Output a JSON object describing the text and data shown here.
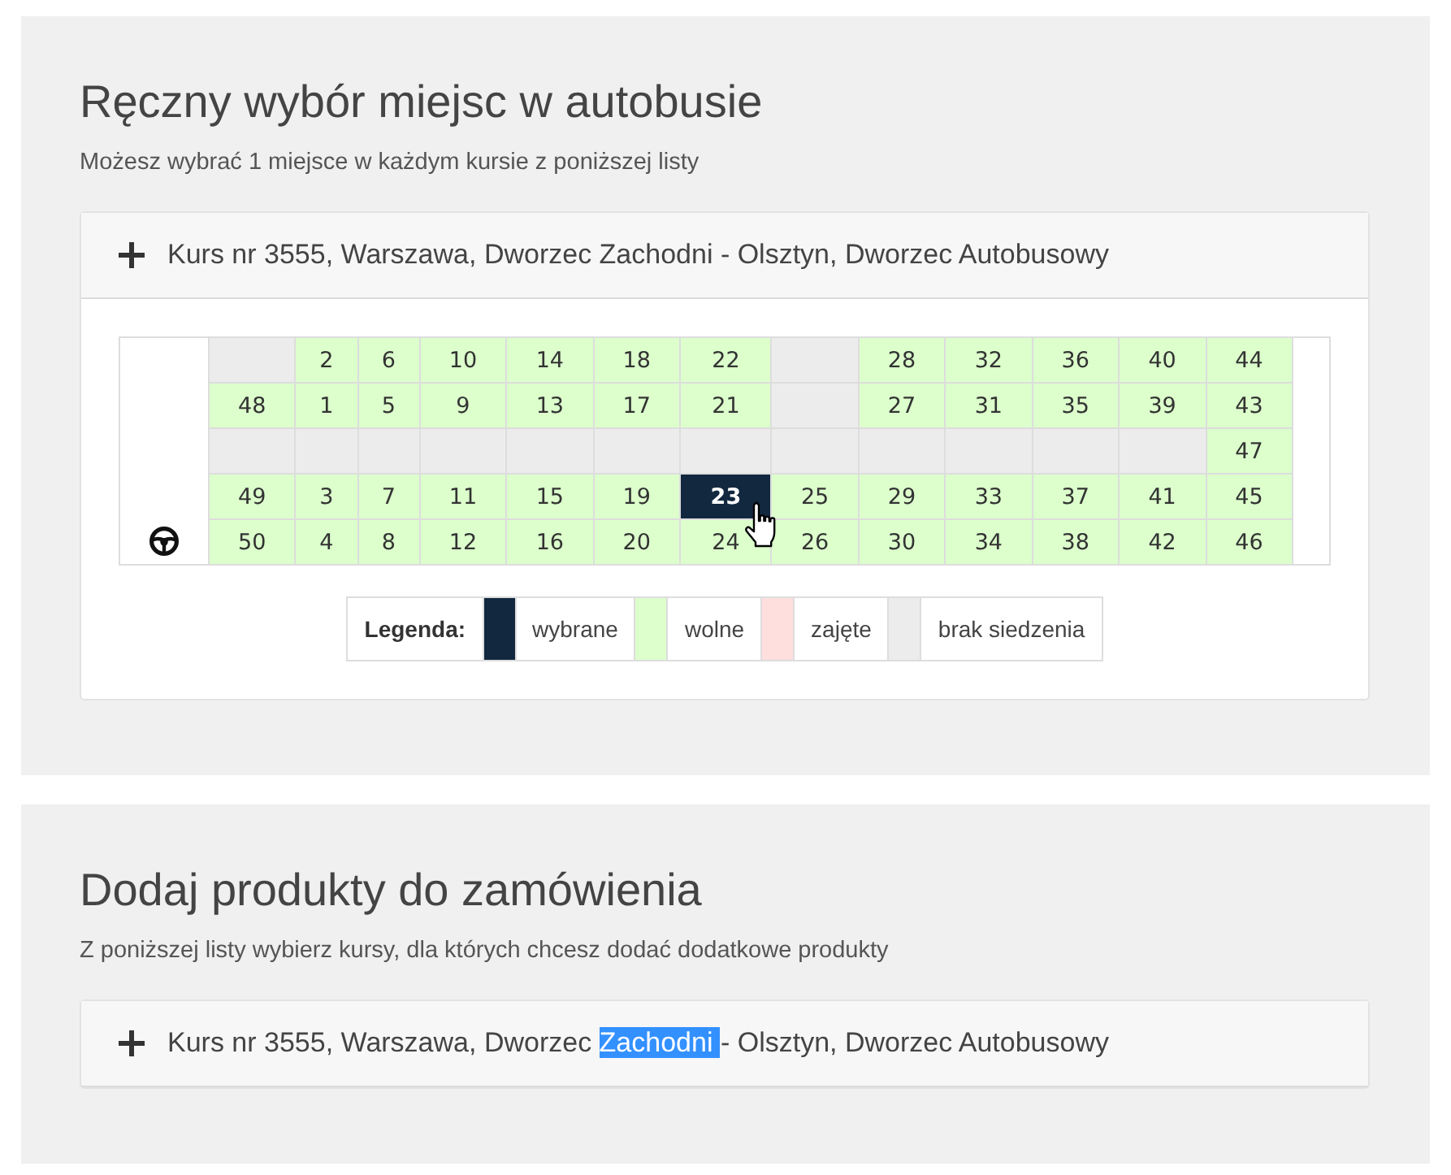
{
  "sections": [
    {
      "title": "Ręczny wybór miejsc w autobusie",
      "subtitle": "Możesz wybrać 1 miejsce w każdym kursie z poniższej listy",
      "courses": [
        {
          "label_parts": [
            {
              "text": "Kurs nr 3555, Warszawa, Dworzec Zachodni - Olsztyn, Dworzec Autobusowy",
              "selected": false
            }
          ],
          "expanded": true,
          "seat_map": {
            "rows": [
              {
                "cells": [
                  {
                    "kind": "blank"
                  },
                  {
                    "kind": "none"
                  },
                  {
                    "kind": "seat",
                    "label": "2",
                    "selected": false,
                    "hovered": false
                  },
                  {
                    "kind": "seat",
                    "label": "6",
                    "selected": false,
                    "hovered": false
                  },
                  {
                    "kind": "seat",
                    "label": "10",
                    "selected": false,
                    "hovered": false
                  },
                  {
                    "kind": "seat",
                    "label": "14",
                    "selected": false,
                    "hovered": false
                  },
                  {
                    "kind": "seat",
                    "label": "18",
                    "selected": false,
                    "hovered": false
                  },
                  {
                    "kind": "seat",
                    "label": "22",
                    "selected": false,
                    "hovered": false
                  },
                  {
                    "kind": "none"
                  },
                  {
                    "kind": "seat",
                    "label": "28",
                    "selected": false,
                    "hovered": false
                  },
                  {
                    "kind": "seat",
                    "label": "32",
                    "selected": false,
                    "hovered": false
                  },
                  {
                    "kind": "seat",
                    "label": "36",
                    "selected": false,
                    "hovered": false
                  },
                  {
                    "kind": "seat",
                    "label": "40",
                    "selected": false,
                    "hovered": false
                  },
                  {
                    "kind": "seat",
                    "label": "44",
                    "selected": false,
                    "hovered": false
                  },
                  {
                    "kind": "blank"
                  }
                ]
              },
              {
                "cells": [
                  {
                    "kind": "blank"
                  },
                  {
                    "kind": "seat",
                    "label": "48",
                    "selected": false,
                    "hovered": false
                  },
                  {
                    "kind": "seat",
                    "label": "1",
                    "selected": false,
                    "hovered": false
                  },
                  {
                    "kind": "seat",
                    "label": "5",
                    "selected": false,
                    "hovered": false
                  },
                  {
                    "kind": "seat",
                    "label": "9",
                    "selected": false,
                    "hovered": false
                  },
                  {
                    "kind": "seat",
                    "label": "13",
                    "selected": false,
                    "hovered": false
                  },
                  {
                    "kind": "seat",
                    "label": "17",
                    "selected": false,
                    "hovered": false
                  },
                  {
                    "kind": "seat",
                    "label": "21",
                    "selected": false,
                    "hovered": false
                  },
                  {
                    "kind": "none"
                  },
                  {
                    "kind": "seat",
                    "label": "27",
                    "selected": false,
                    "hovered": false
                  },
                  {
                    "kind": "seat",
                    "label": "31",
                    "selected": false,
                    "hovered": false
                  },
                  {
                    "kind": "seat",
                    "label": "35",
                    "selected": false,
                    "hovered": false
                  },
                  {
                    "kind": "seat",
                    "label": "39",
                    "selected": false,
                    "hovered": false
                  },
                  {
                    "kind": "seat",
                    "label": "43",
                    "selected": false,
                    "hovered": false
                  },
                  {
                    "kind": "blank"
                  }
                ]
              },
              {
                "cells": [
                  {
                    "kind": "blank"
                  },
                  {
                    "kind": "none"
                  },
                  {
                    "kind": "none"
                  },
                  {
                    "kind": "none"
                  },
                  {
                    "kind": "none"
                  },
                  {
                    "kind": "none"
                  },
                  {
                    "kind": "none"
                  },
                  {
                    "kind": "none"
                  },
                  {
                    "kind": "none"
                  },
                  {
                    "kind": "none"
                  },
                  {
                    "kind": "none"
                  },
                  {
                    "kind": "none"
                  },
                  {
                    "kind": "none"
                  },
                  {
                    "kind": "seat",
                    "label": "47",
                    "selected": false,
                    "hovered": false
                  },
                  {
                    "kind": "blank"
                  }
                ]
              },
              {
                "cells": [
                  {
                    "kind": "blank"
                  },
                  {
                    "kind": "seat",
                    "label": "49",
                    "selected": false,
                    "hovered": false
                  },
                  {
                    "kind": "seat",
                    "label": "3",
                    "selected": false,
                    "hovered": false
                  },
                  {
                    "kind": "seat",
                    "label": "7",
                    "selected": false,
                    "hovered": false
                  },
                  {
                    "kind": "seat",
                    "label": "11",
                    "selected": false,
                    "hovered": false
                  },
                  {
                    "kind": "seat",
                    "label": "15",
                    "selected": false,
                    "hovered": false
                  },
                  {
                    "kind": "seat",
                    "label": "19",
                    "selected": false,
                    "hovered": false
                  },
                  {
                    "kind": "seat",
                    "label": "23",
                    "selected": true,
                    "hovered": true
                  },
                  {
                    "kind": "seat",
                    "label": "25",
                    "selected": false,
                    "hovered": false
                  },
                  {
                    "kind": "seat",
                    "label": "29",
                    "selected": false,
                    "hovered": false
                  },
                  {
                    "kind": "seat",
                    "label": "33",
                    "selected": false,
                    "hovered": false
                  },
                  {
                    "kind": "seat",
                    "label": "37",
                    "selected": false,
                    "hovered": false
                  },
                  {
                    "kind": "seat",
                    "label": "41",
                    "selected": false,
                    "hovered": false
                  },
                  {
                    "kind": "seat",
                    "label": "45",
                    "selected": false,
                    "hovered": false
                  },
                  {
                    "kind": "blank"
                  }
                ]
              },
              {
                "cells": [
                  {
                    "kind": "driver"
                  },
                  {
                    "kind": "seat",
                    "label": "50",
                    "selected": false,
                    "hovered": false
                  },
                  {
                    "kind": "seat",
                    "label": "4",
                    "selected": false,
                    "hovered": false
                  },
                  {
                    "kind": "seat",
                    "label": "8",
                    "selected": false,
                    "hovered": false
                  },
                  {
                    "kind": "seat",
                    "label": "12",
                    "selected": false,
                    "hovered": false
                  },
                  {
                    "kind": "seat",
                    "label": "16",
                    "selected": false,
                    "hovered": false
                  },
                  {
                    "kind": "seat",
                    "label": "20",
                    "selected": false,
                    "hovered": false
                  },
                  {
                    "kind": "seat",
                    "label": "24",
                    "selected": false,
                    "hovered": false
                  },
                  {
                    "kind": "seat",
                    "label": "26",
                    "selected": false,
                    "hovered": false
                  },
                  {
                    "kind": "seat",
                    "label": "30",
                    "selected": false,
                    "hovered": false
                  },
                  {
                    "kind": "seat",
                    "label": "34",
                    "selected": false,
                    "hovered": false
                  },
                  {
                    "kind": "seat",
                    "label": "38",
                    "selected": false,
                    "hovered": false
                  },
                  {
                    "kind": "seat",
                    "label": "42",
                    "selected": false,
                    "hovered": false
                  },
                  {
                    "kind": "seat",
                    "label": "46",
                    "selected": false,
                    "hovered": false
                  },
                  {
                    "kind": "blank"
                  }
                ]
              }
            ]
          },
          "legend": {
            "label": "Legenda:",
            "items": [
              {
                "label": "wybrane",
                "color": "#12283f"
              },
              {
                "label": "wolne",
                "color": "#dcffcc"
              },
              {
                "label": "zajęte",
                "color": "#ffdede"
              },
              {
                "label": "brak siedzenia",
                "color": "#ececec"
              }
            ]
          }
        }
      ]
    },
    {
      "title": "Dodaj produkty do zamówienia",
      "subtitle": "Z poniższej listy wybierz kursy, dla których chcesz dodać dodatkowe produkty",
      "courses": [
        {
          "label_parts": [
            {
              "text": "Kurs nr 3555, Warszawa, Dworzec ",
              "selected": false
            },
            {
              "text": "Zachodni ",
              "selected": true
            },
            {
              "text": "- Olsztyn, Dworzec Autobusowy",
              "selected": false
            }
          ],
          "expanded": false
        }
      ]
    }
  ]
}
